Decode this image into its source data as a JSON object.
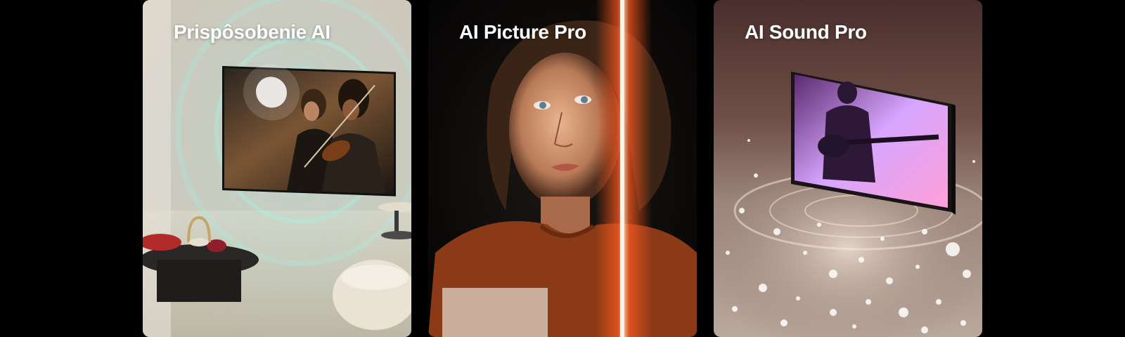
{
  "cards": [
    {
      "title": "Prispôsobenie AI"
    },
    {
      "title": "AI Picture Pro"
    },
    {
      "title": "AI Sound Pro"
    }
  ],
  "colors": {
    "background": "#000000",
    "title_text": "#ffffff",
    "card1_accent": "#9fe6dc",
    "card2_accent": "#ff5a1f",
    "card3_accent": "#d7a6ff"
  }
}
